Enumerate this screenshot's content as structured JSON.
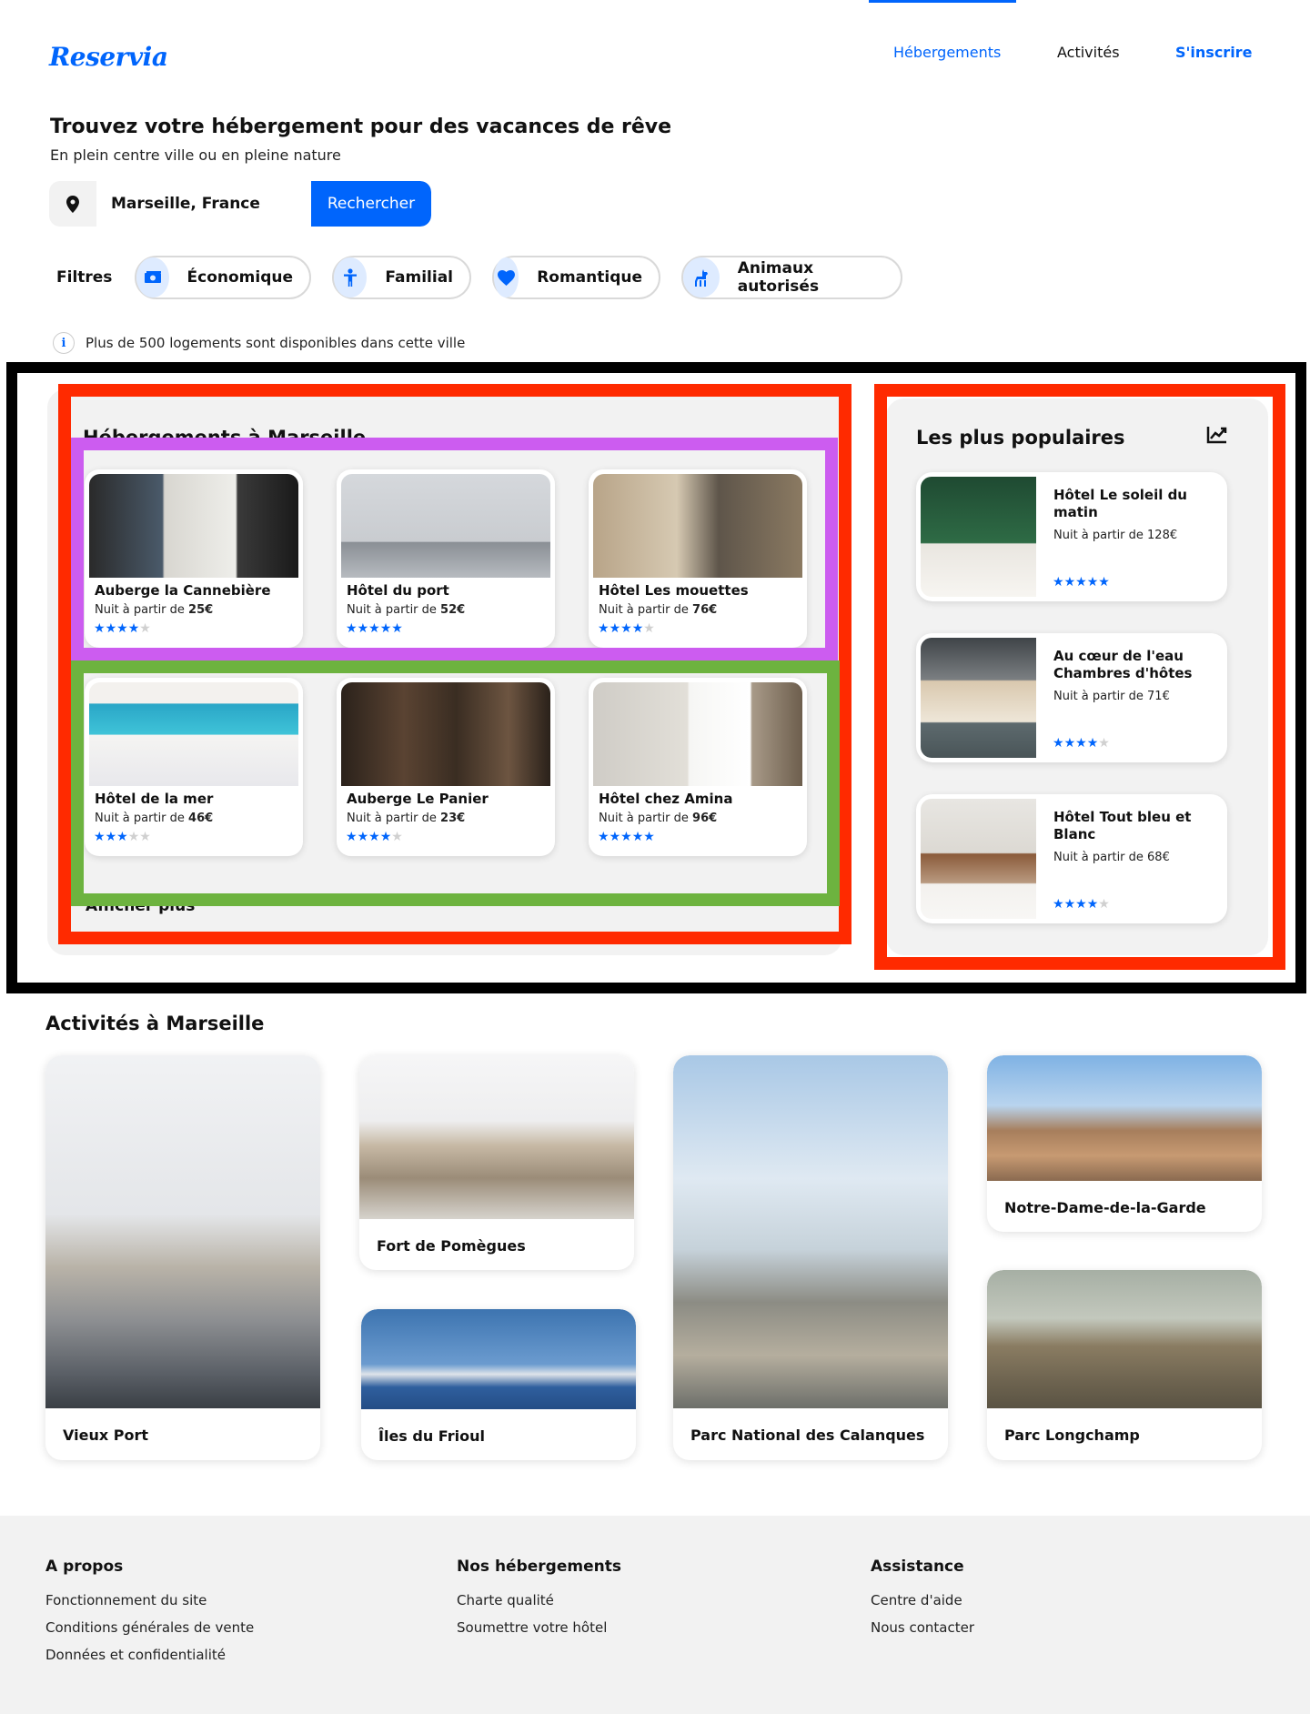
{
  "brand": "Reservia",
  "nav": {
    "items": [
      "Hébergements",
      "Activités",
      "S'inscrire"
    ]
  },
  "hero": {
    "title": "Trouvez votre hébergement pour des vacances de rêve",
    "subtitle": "En plein centre ville ou en pleine nature",
    "search_value": "Marseille, France",
    "search_button": "Rechercher"
  },
  "filters": {
    "label": "Filtres",
    "items": [
      {
        "label": "Économique",
        "icon": "money-icon"
      },
      {
        "label": "Familial",
        "icon": "person-icon"
      },
      {
        "label": "Romantique",
        "icon": "heart-icon"
      },
      {
        "label": "Animaux autorisés",
        "icon": "dog-icon"
      }
    ]
  },
  "info_text": "Plus de 500 logements sont disponibles dans cette ville",
  "accommodations": {
    "title": "Hébergements à Marseille",
    "more": "Afficher plus",
    "price_prefix": "Nuit à partir de ",
    "items": [
      {
        "name": "Auberge la Cannebière",
        "price": "25€",
        "rating": 4
      },
      {
        "name": "Hôtel du port",
        "price": "52€",
        "rating": 5
      },
      {
        "name": "Hôtel Les mouettes",
        "price": "76€",
        "rating": 4
      },
      {
        "name": "Hôtel de la mer",
        "price": "46€",
        "rating": 3
      },
      {
        "name": "Auberge Le Panier",
        "price": "23€",
        "rating": 4
      },
      {
        "name": "Hôtel chez Amina",
        "price": "96€",
        "rating": 5
      }
    ]
  },
  "popular": {
    "title": "Les plus populaires",
    "items": [
      {
        "name": "Hôtel Le soleil du matin",
        "price": "Nuit à partir de 128€",
        "rating": 5
      },
      {
        "name": "Au cœur de l'eau Chambres d'hôtes",
        "price": "Nuit à partir de 71€",
        "rating": 4
      },
      {
        "name": "Hôtel Tout bleu et Blanc",
        "price": "Nuit à partir de 68€",
        "rating": 4
      }
    ]
  },
  "activities": {
    "title": "Activités à Marseille",
    "items": [
      "Vieux Port",
      "Fort de Pomègues",
      "Îles du Frioul",
      "Parc National des Calanques",
      "Notre-Dame-de-la-Garde",
      "Parc Longchamp"
    ]
  },
  "footer": {
    "columns": [
      {
        "title": "A propos",
        "links": [
          "Fonctionnement du site",
          "Conditions générales de vente",
          "Données et confidentialité"
        ]
      },
      {
        "title": "Nos hébergements",
        "links": [
          "Charte qualité",
          "Soumettre votre hôtel"
        ]
      },
      {
        "title": "Assistance",
        "links": [
          "Centre d'aide",
          "Nous contacter"
        ]
      }
    ]
  },
  "colors": {
    "primary": "#0065fc",
    "chip_icon_bg": "#deebff",
    "panel_bg": "#f2f2f2",
    "frame_black": "#000000",
    "frame_red": "#ff2a00",
    "frame_purple": "#cc5cf0",
    "frame_green": "#6db33f"
  }
}
